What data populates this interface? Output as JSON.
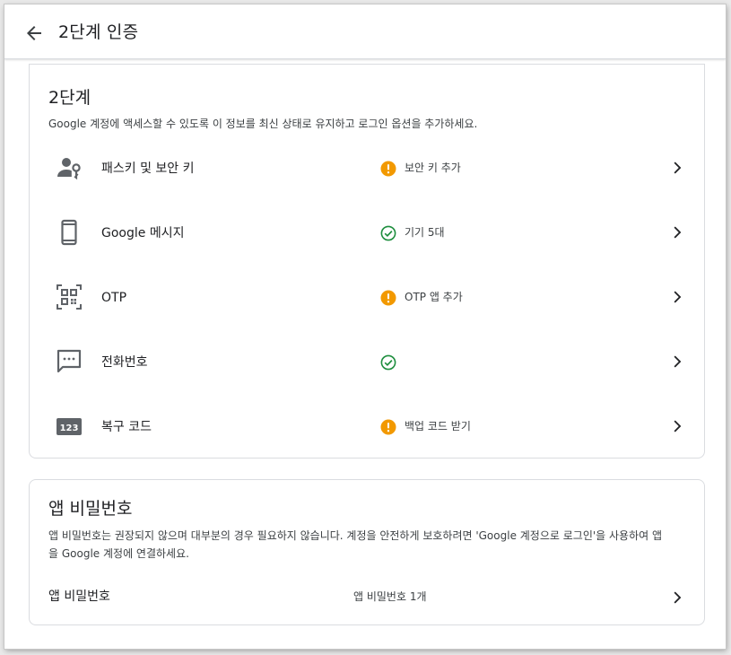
{
  "header": {
    "title": "2단계 인증",
    "back_icon": "arrow-back-icon"
  },
  "two_step": {
    "title": "2단계",
    "description": "Google 계정에 액세스할 수 있도록 이 정보를 최신 상태로 유지하고 로그인 옵션을 추가하세요.",
    "items": [
      {
        "label": "패스키 및 보안 키",
        "icon": "passkey-icon",
        "status": "warning",
        "status_text": "보안 키 추가"
      },
      {
        "label": "Google 메시지",
        "icon": "phone-icon",
        "status": "ok",
        "status_text": "기기 5대"
      },
      {
        "label": "OTP",
        "icon": "qr-code-icon",
        "status": "warning",
        "status_text": "OTP 앱 추가"
      },
      {
        "label": "전화번호",
        "icon": "sms-icon",
        "status": "ok",
        "status_text": ""
      },
      {
        "label": "복구 코드",
        "icon": "backup-code-icon",
        "status": "warning",
        "status_text": "백업 코드 받기"
      }
    ]
  },
  "app_passwords": {
    "title": "앱 비밀번호",
    "description_line1": "앱 비밀번호는 권장되지 않으며 대부분의 경우 필요하지 않습니다. 계정을 안전하게 보호하려면 'Google 계정으로 로그인'을 사용하여 앱",
    "description_line2": "을 Google 계정에 연결하세요.",
    "row_label": "앱 비밀번호",
    "row_value": "앱 비밀번호 1개"
  },
  "colors": {
    "warning": "#f29900",
    "ok": "#1e8e3e",
    "icon": "#5f6368",
    "text": "#202124"
  }
}
